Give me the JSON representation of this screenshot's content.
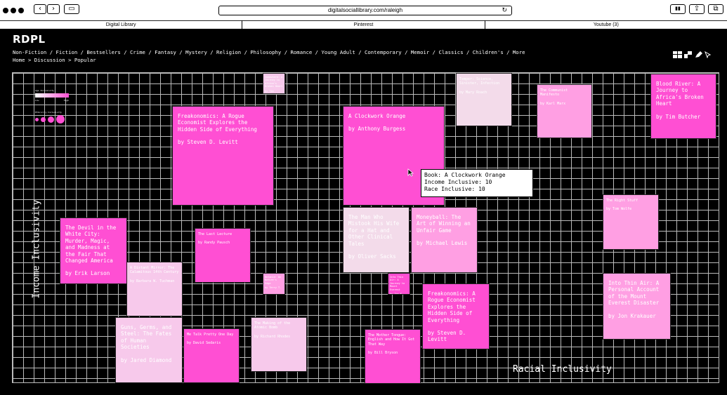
{
  "browser": {
    "url": "digitalsociallibrary.com/raleigh",
    "reload_glyph": "↻",
    "back_glyph": "‹",
    "forward_glyph": "›",
    "sidebar_glyph": "▭",
    "share_glyph": "⇪",
    "tabs_glyph": "⧉",
    "reader_glyph": "▮▮",
    "tabs": [
      "Digital Library",
      "Pinterest",
      "Youtube (3)"
    ]
  },
  "site": {
    "brand": "RDPL",
    "genres": [
      "Non-Fiction",
      "Fiction",
      "Bestsellers",
      "Crime",
      "Fantasy",
      "Mystery",
      "Religion",
      "Philosophy",
      "Romance",
      "Young Adult",
      "Contemporary",
      "Memoir",
      "Classics",
      "Children's",
      "More"
    ],
    "breadcrumb": "Home > Discussion > Popular"
  },
  "legend": {
    "age_title": "Age Inclusivity",
    "age_low": "Low",
    "age_high": "High",
    "ethnic_title": "Ethnicity Inclusivity"
  },
  "axes": {
    "y_label": "Income Inclusivity",
    "x_label": "Racial Inclusivity"
  },
  "tooltip": {
    "book": "Book: A Clockwork Orange",
    "income": "Income Inclusive: 10",
    "race": "Race Inclusive: 10"
  },
  "colors": {
    "hot": "#ff4fd3",
    "mid": "#ff7ddc",
    "light": "#ff9fe3",
    "pale": "#f7c9eb",
    "paler": "#f3dbea"
  },
  "books": [
    {
      "title": "Somewhere: A Journey to Africa's Broken Heart",
      "author": "by Tim Butcher",
      "color": "pale"
    },
    {
      "title": "Freakonomics: A Rogue Economist Explores the Hidden Side of Everything",
      "author": "by Steven D. Levitt",
      "color": "hot"
    },
    {
      "title": "A Clockwork Orange",
      "author": "by Anthony Burgess",
      "color": "hot"
    },
    {
      "title": "Temper: Science, Sinister, Infection",
      "author": "by Mary Roach",
      "color": "paler"
    },
    {
      "title": "The Communist Manifesto",
      "author": "by Karl Marx",
      "color": "light"
    },
    {
      "title": "Blood River: A Journey to Africa's Broken Heart",
      "author": "by Tim Butcher",
      "color": "hot"
    },
    {
      "title": "The Devil in the White City: Murder, Magic, and Madness at the Fair That Changed America",
      "author": "by Erik Larson",
      "color": "hot"
    },
    {
      "title": "The Last Lecture",
      "author": "by Randy Pausch",
      "color": "hot"
    },
    {
      "title": "The Man Who Mistook His Wife for a Hat and Other Clinical Tales",
      "author": "by Oliver Sacks",
      "color": "paler"
    },
    {
      "title": "Moneyball: The Art of Winning an Unfair Game",
      "author": "by Michael Lewis",
      "color": "light"
    },
    {
      "title": "The Right Stuff",
      "author": "by Tom Wolfe",
      "color": "light"
    },
    {
      "title": "A Distant Mirror: The Calamitous 14th Century",
      "author": "by Barbara W. Tuchman",
      "color": "pale"
    },
    {
      "title": "Botanie: On Nature's Edge",
      "author": "by Terry T.",
      "color": "light"
    },
    {
      "title": "Into Thin Air: A Journey to Mount Everest",
      "author": "by Jon K.",
      "color": "hot"
    },
    {
      "title": "Freakonomics: A Rogue Economist Explores the Hidden Side of Everything",
      "author": "by Steven D. Levitt",
      "color": "hot"
    },
    {
      "title": "Into Thin Air: A Personal Account of the Mount Everest Disaster",
      "author": "by Jon Krakauer",
      "color": "light"
    },
    {
      "title": "Guns, Germs, and Steel: The Fates of Human Societies",
      "author": "by Jared Diamond",
      "color": "pale"
    },
    {
      "title": "Me Talk Pretty One Day",
      "author": "by David Sedaris",
      "color": "hot"
    },
    {
      "title": "The Making of the Atomic Bomb",
      "author": "by Richard Rhodes",
      "color": "pale"
    },
    {
      "title": "The Mother Tongue: English and How It Got That Way",
      "author": "by Bill Bryson",
      "color": "hot"
    }
  ]
}
